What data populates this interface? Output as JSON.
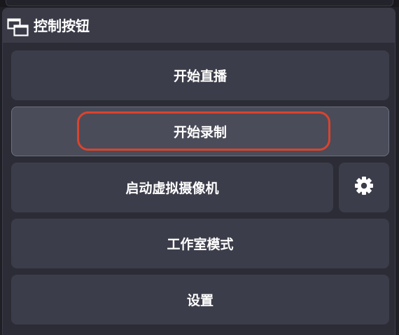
{
  "dock": {
    "title": "控制按钮",
    "icon": "dock-window-icon"
  },
  "buttons": {
    "start_streaming": "开始直播",
    "start_recording": "开始录制",
    "start_virtual_camera": "启动虚拟摄像机",
    "virtual_camera_settings_icon": "gear-icon",
    "studio_mode": "工作室模式",
    "settings": "设置"
  },
  "colors": {
    "highlight": "#d9442e",
    "button": "#3c3d4a",
    "button_active": "#4a4c59"
  }
}
